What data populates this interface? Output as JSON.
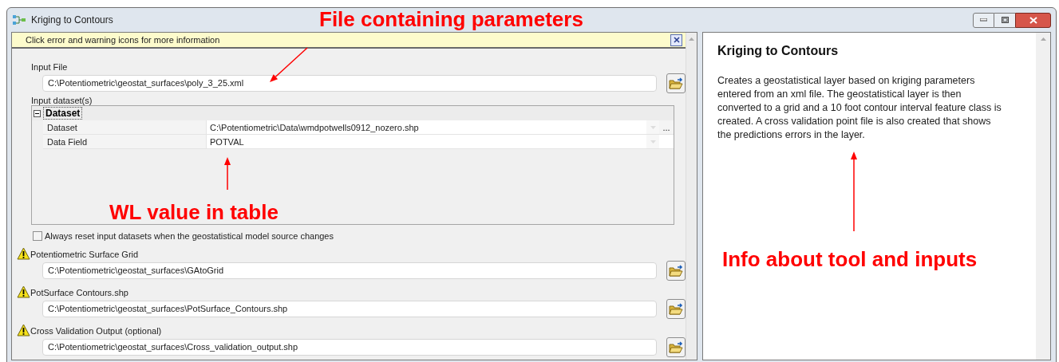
{
  "window": {
    "title": "Kriging to Contours"
  },
  "message_bar": {
    "text": "Click error and warning icons for more information"
  },
  "input_file": {
    "label": "Input File",
    "value": "C:\\Potentiometric\\geostat_surfaces\\poly_3_25.xml"
  },
  "input_datasets": {
    "label": "Input dataset(s)",
    "group": {
      "label": "Dataset",
      "expanded": true
    },
    "rows": [
      {
        "name": "Dataset",
        "value": "C:\\Potentiometric\\Data\\wmdpotwells0912_nozero.shp",
        "browse": "..."
      },
      {
        "name": "Data Field",
        "value": "POTVAL"
      }
    ]
  },
  "reset_checkbox": {
    "label": "Always reset input datasets when the geostatistical model source changes",
    "checked": false
  },
  "outputs": [
    {
      "label": "Potentiometric Surface Grid",
      "warning": true,
      "value": "C:\\Potentiometric\\geostat_surfaces\\GAtoGrid"
    },
    {
      "label": "PotSurface Contours.shp",
      "warning": true,
      "value": "C:\\Potentiometric\\geostat_surfaces\\PotSurface_Contours.shp"
    },
    {
      "label": "Cross Validation Output (optional)",
      "warning": true,
      "value": "C:\\Potentiometric\\geostat_surfaces\\Cross_validation_output.shp"
    }
  ],
  "help": {
    "title": "Kriging to Contours",
    "body": "Creates a geostatistical layer based on kriging parameters entered from an xml file. The geostatistical layer is then converted to a grid and a 10 foot contour interval feature class is created. A cross validation point file is also created that shows the predictions errors in the layer."
  },
  "annotations": [
    {
      "text": "File containing parameters"
    },
    {
      "text": "WL value in table"
    },
    {
      "text": "Info about tool and inputs"
    }
  ]
}
